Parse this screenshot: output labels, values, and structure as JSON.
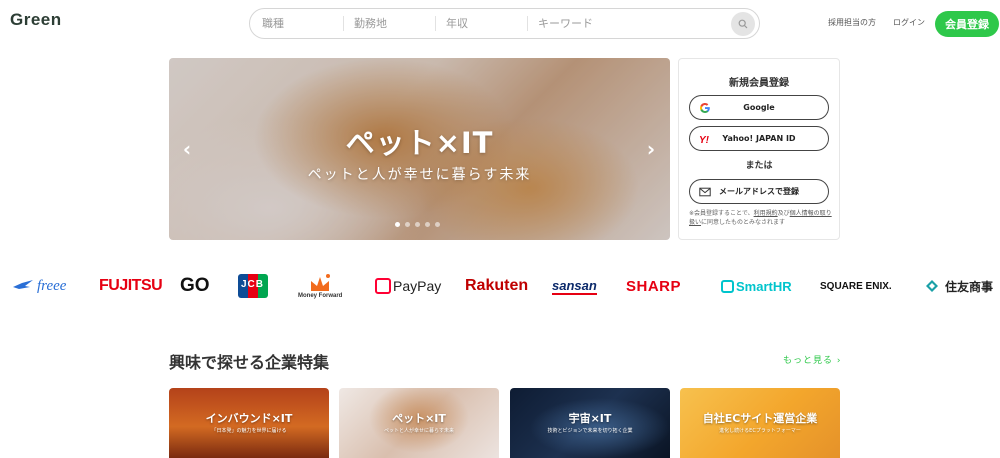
{
  "header": {
    "logo": "Green",
    "search": {
      "job_type": "職種",
      "location": "勤務地",
      "salary": "年収",
      "keyword_placeholder": "キーワード"
    },
    "recruiter_link": "採用担当の方",
    "login_link": "ログイン",
    "signup_button": "会員登録",
    "accent_color": "#2ec84a"
  },
  "hero": {
    "title": "ペット×IT",
    "subtitle": "ペットと人が幸せに暮らす未来",
    "slide_count": 5,
    "active_slide": 1
  },
  "register": {
    "title": "新規会員登録",
    "google_label": "Google",
    "yahoo_label": "Yahoo! JAPAN ID",
    "or_label": "または",
    "mail_label": "メールアドレスで登録",
    "note_prefix": "※会員登録することで、",
    "terms_link": "利用規約",
    "note_and": "及び",
    "privacy_link": "個人情報の取り扱い",
    "note_suffix": "に同意したものとみなされます"
  },
  "logos": {
    "freee": "freee",
    "fujitsu": "FUJITSU",
    "go": "GO",
    "jcb": "JCB",
    "money_forward": "Money Forward",
    "paypay": "PayPay",
    "rakuten": "Rakuten",
    "sansan": "sansan",
    "sharp": "SHARP",
    "smarthr": "SmartHR",
    "square_enix": "SQUARE ENIX.",
    "sumitomo": "住友商事"
  },
  "features": {
    "title": "興味で探せる企業特集",
    "more_link": "もっと見る",
    "cards": [
      {
        "title": "インバウンド×IT",
        "subtitle": "「日本発」の魅力を世界に届ける"
      },
      {
        "title": "ペット×IT",
        "subtitle": "ペットと人が幸せに暮らす未来"
      },
      {
        "title": "宇宙×IT",
        "subtitle": "技術とビジョンで未来を切り拓く企業"
      },
      {
        "title": "自社ECサイト運営企業",
        "subtitle": "進化し続けるECプラットフォーマー"
      }
    ]
  }
}
